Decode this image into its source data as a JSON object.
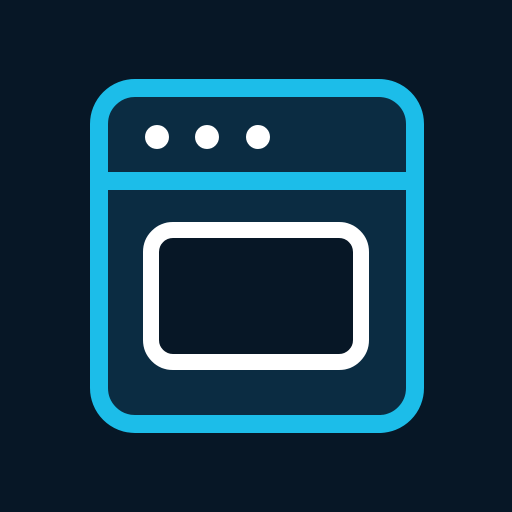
{
  "colors": {
    "background": "#071726",
    "oven_body": "#0B2C42",
    "outline": "#1CBDE9",
    "dots": "#FFFFFF",
    "window_border": "#FFFFFF",
    "window_fill": "#071726"
  },
  "icon": {
    "name": "oven-icon",
    "control_dots": 3
  }
}
